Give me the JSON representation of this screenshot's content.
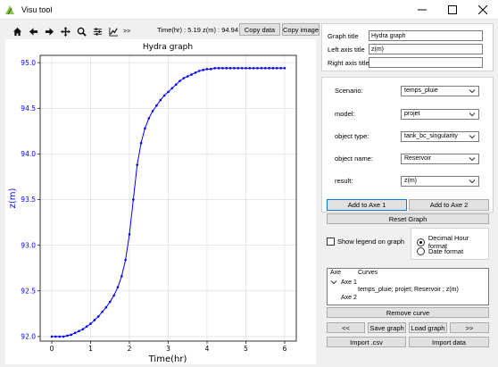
{
  "window": {
    "title": "Visu tool"
  },
  "toolbar": {
    "icons": [
      "home-icon",
      "back-arrow-icon",
      "forward-arrow-icon",
      "pan-icon",
      "zoom-icon",
      "subplots-icon",
      "line-edit-icon"
    ],
    "more": ">>",
    "coords": "Time(hr) : 5.19   z(m) : 94.94",
    "copy_data": "Copy data",
    "copy_image": "Copy image"
  },
  "form": {
    "graph_title_label": "Graph title",
    "graph_title_value": "Hydra graph",
    "left_axis_label": "Left axis title",
    "left_axis_value": "z(m)",
    "right_axis_label": "Right axis title",
    "right_axis_value": ""
  },
  "selects": [
    {
      "label": "Scenario:",
      "value": "temps_pluie"
    },
    {
      "label": "model:",
      "value": "projet"
    },
    {
      "label": "object type:",
      "value": "tank_bc_singularity"
    },
    {
      "label": "object name:",
      "value": "Reservoir"
    },
    {
      "label": "result:",
      "value": "z(m)"
    }
  ],
  "buttons": {
    "add_axe1": "Add to Axe 1",
    "add_axe2": "Add to Axe 2",
    "reset_graph": "Reset Graph",
    "remove_curve": "Remove curve",
    "prev": "<<",
    "save_graph": "Save graph",
    "load_graph": "Load graph",
    "next": ">>",
    "import_csv": "Import .csv",
    "import_data": "Import data"
  },
  "legend": {
    "show_legend_label": "Show legend on graph"
  },
  "format": {
    "decimal_label": "Decimal Hour format",
    "date_label": "Date format",
    "selected": "decimal"
  },
  "curves": {
    "header_axe": "Axe",
    "header_curves": "Curves",
    "axe1": "Axe 1",
    "axe1_curve": "temps_pluie; projet; Reservoir ; z(m)",
    "axe2": "Axe 2"
  },
  "chart_data": {
    "type": "line",
    "title": "Hydra graph",
    "xlabel": "Time(hr)",
    "ylabel": "z(m)",
    "xlim": [
      -0.3,
      6.3
    ],
    "ylim": [
      91.95,
      95.08
    ],
    "xticks": [
      0,
      1,
      2,
      3,
      4,
      5,
      6
    ],
    "yticks": [
      92.0,
      92.5,
      93.0,
      93.5,
      94.0,
      94.5,
      95.0
    ],
    "grid": true,
    "color": "#0000ff",
    "series": [
      {
        "x": [
          0,
          0.1,
          0.2,
          0.3,
          0.4,
          0.5,
          0.6,
          0.7,
          0.8,
          0.9,
          1.0,
          1.1,
          1.2,
          1.3,
          1.4,
          1.5,
          1.6,
          1.7,
          1.8,
          1.9,
          2.0,
          2.1,
          2.2,
          2.3,
          2.4,
          2.5,
          2.6,
          2.7,
          2.8,
          2.9,
          3.0,
          3.1,
          3.2,
          3.3,
          3.4,
          3.5,
          3.6,
          3.7,
          3.8,
          3.9,
          4.0,
          4.1,
          4.2,
          4.3,
          4.4,
          4.5,
          4.6,
          4.7,
          4.8,
          4.9,
          5.0,
          5.1,
          5.2,
          5.3,
          5.4,
          5.5,
          5.6,
          5.7,
          5.8,
          5.9,
          6.0
        ],
        "y": [
          92.0,
          92.0,
          92.0,
          92.0,
          92.01,
          92.02,
          92.04,
          92.06,
          92.08,
          92.11,
          92.14,
          92.18,
          92.22,
          92.27,
          92.32,
          92.38,
          92.45,
          92.54,
          92.66,
          92.84,
          93.12,
          93.5,
          93.88,
          94.12,
          94.28,
          94.39,
          94.47,
          94.53,
          94.59,
          94.64,
          94.68,
          94.72,
          94.76,
          94.8,
          94.83,
          94.85,
          94.87,
          94.89,
          94.91,
          94.92,
          94.93,
          94.93,
          94.94,
          94.94,
          94.94,
          94.94,
          94.94,
          94.94,
          94.94,
          94.94,
          94.94,
          94.94,
          94.94,
          94.94,
          94.94,
          94.94,
          94.94,
          94.94,
          94.94,
          94.94,
          94.94
        ]
      }
    ]
  }
}
